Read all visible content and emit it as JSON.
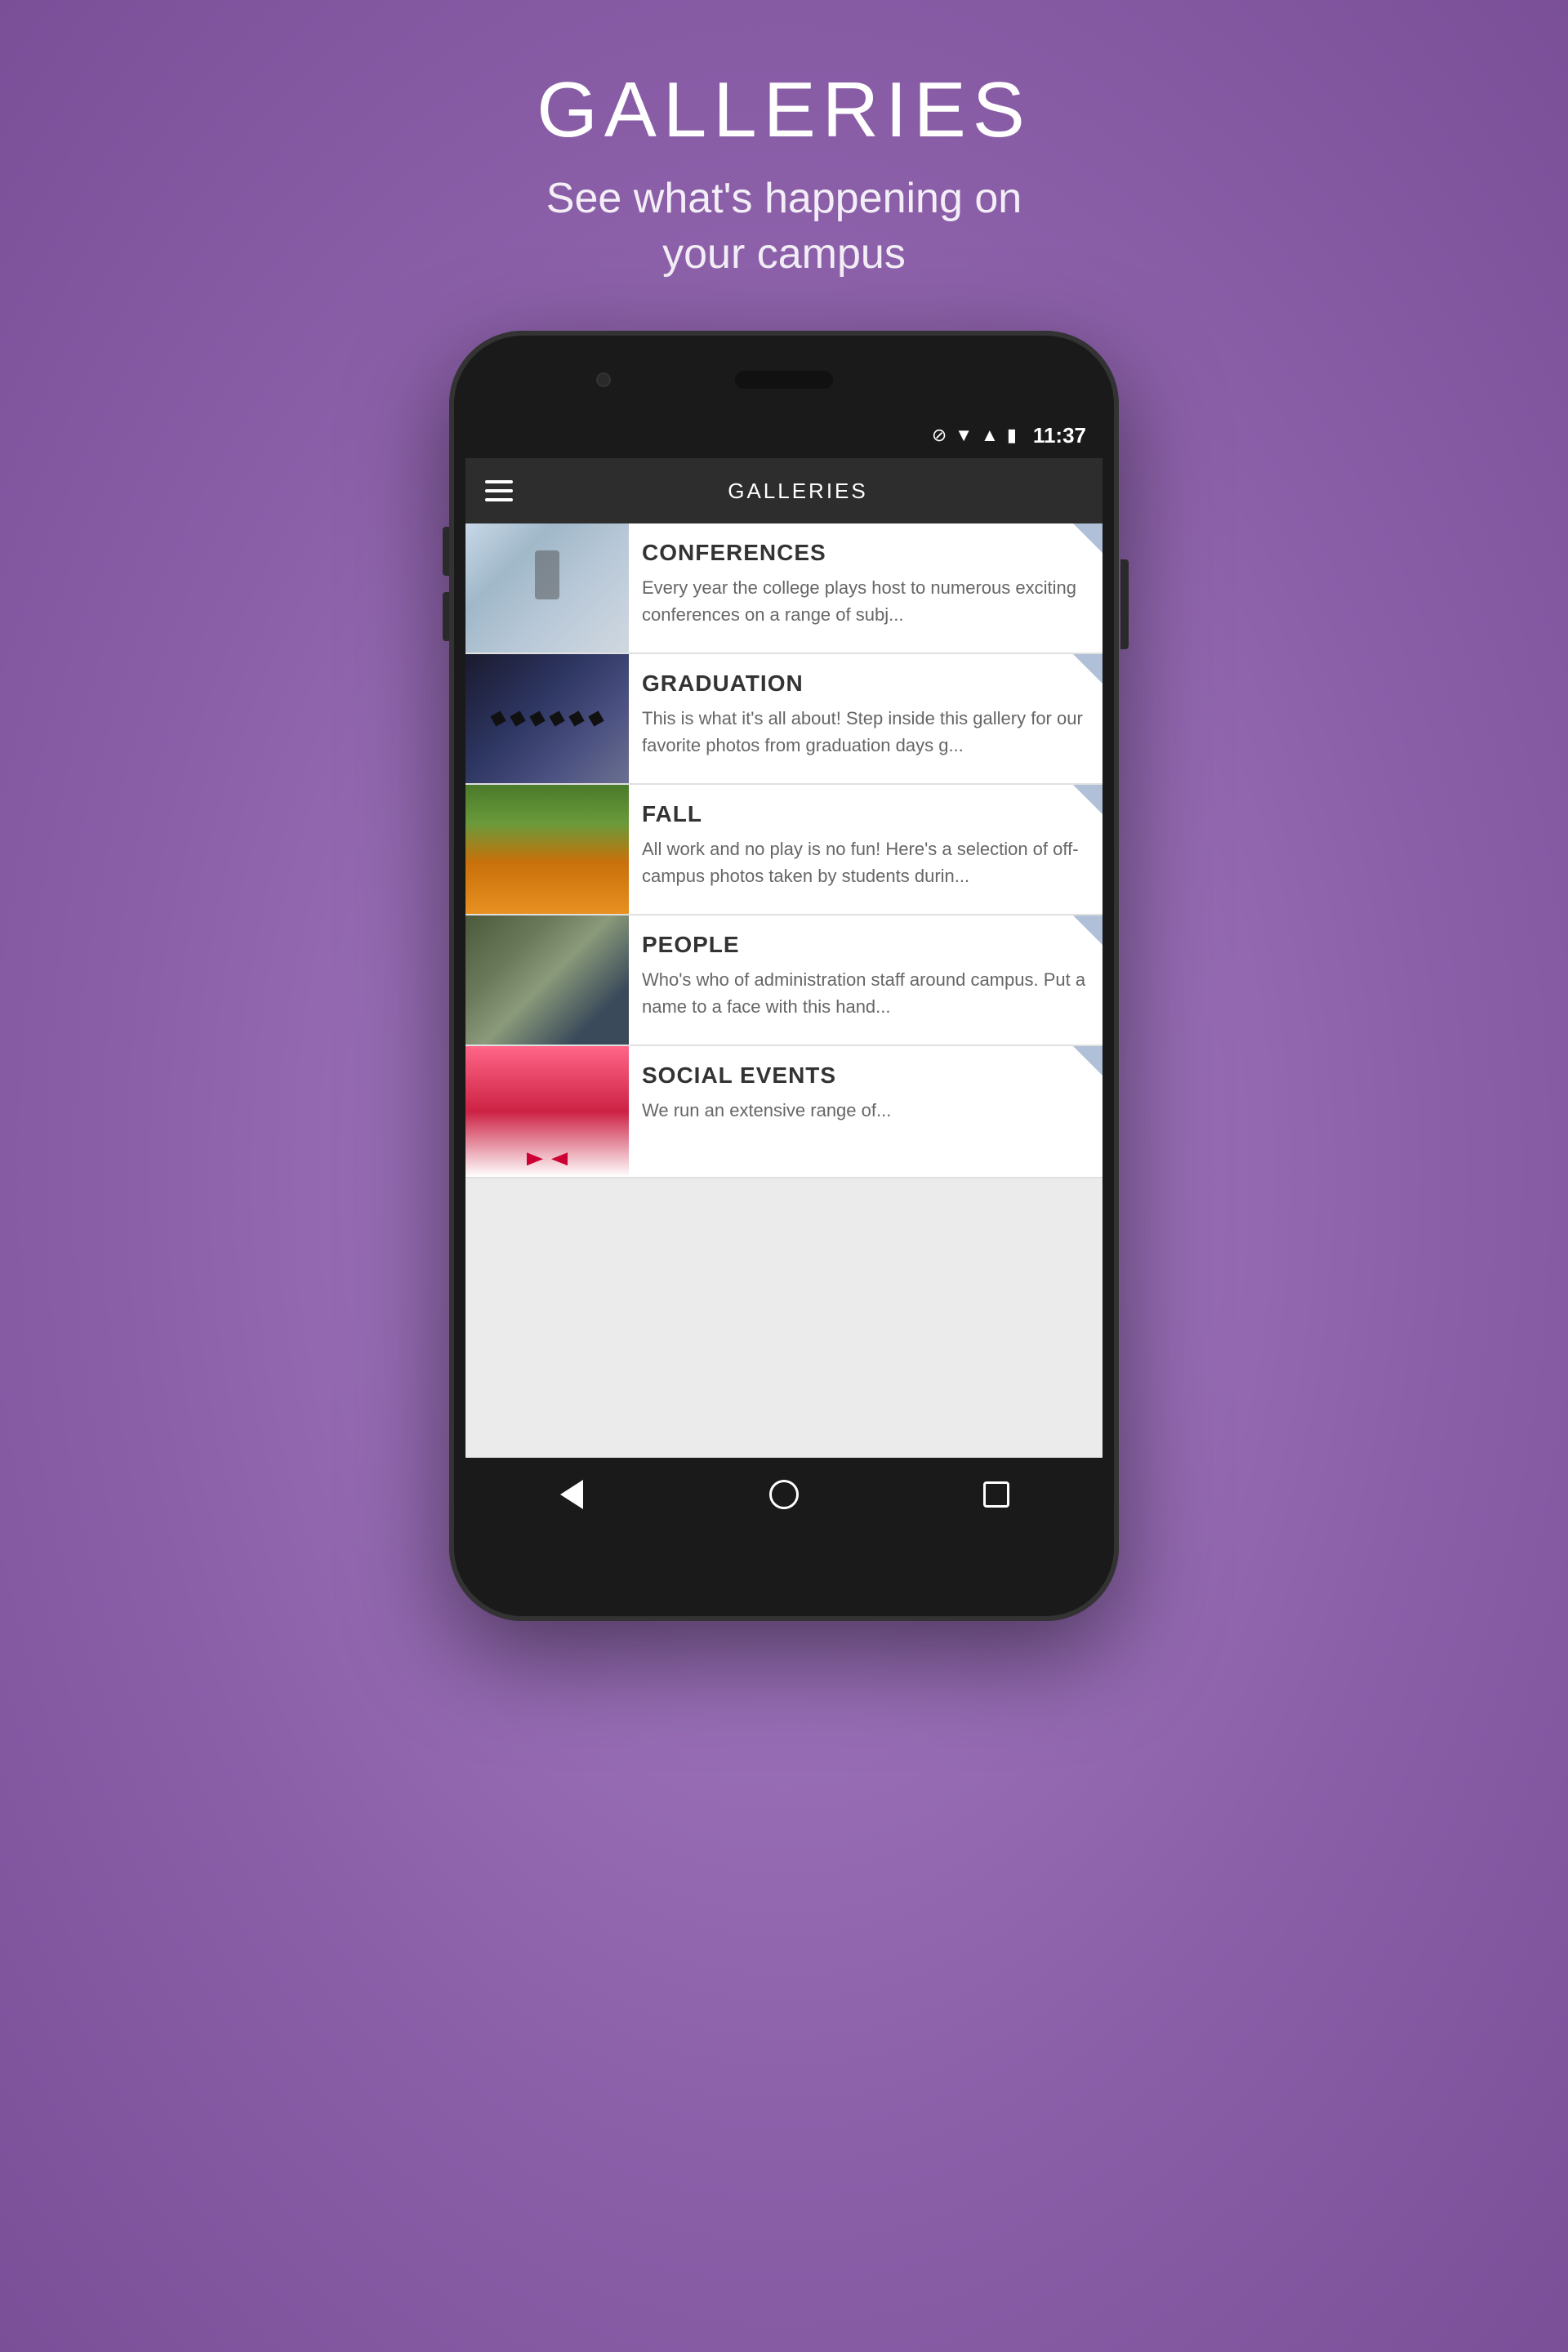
{
  "page": {
    "title": "GALLERIES",
    "subtitle": "See what's happening on\nyour campus"
  },
  "statusBar": {
    "time": "11:37"
  },
  "appHeader": {
    "title": "GALLERIES"
  },
  "galleryItems": [
    {
      "id": "conferences",
      "title": "CONFERENCES",
      "description": "Every year the college plays host to numerous exciting conferences on a range of subj..."
    },
    {
      "id": "graduation",
      "title": "GRADUATION",
      "description": "This is what it's all about!  Step inside this gallery for our favorite photos from graduation days g..."
    },
    {
      "id": "fall",
      "title": "FALL",
      "description": "All work and no play is no fun!  Here's a selection of off-campus photos taken by students durin..."
    },
    {
      "id": "people",
      "title": "PEOPLE",
      "description": "Who's who of administration staff around campus.  Put a name to a face with this hand..."
    },
    {
      "id": "social-events",
      "title": "SOCIAL EVENTS",
      "description": "We run an extensive range of..."
    }
  ]
}
